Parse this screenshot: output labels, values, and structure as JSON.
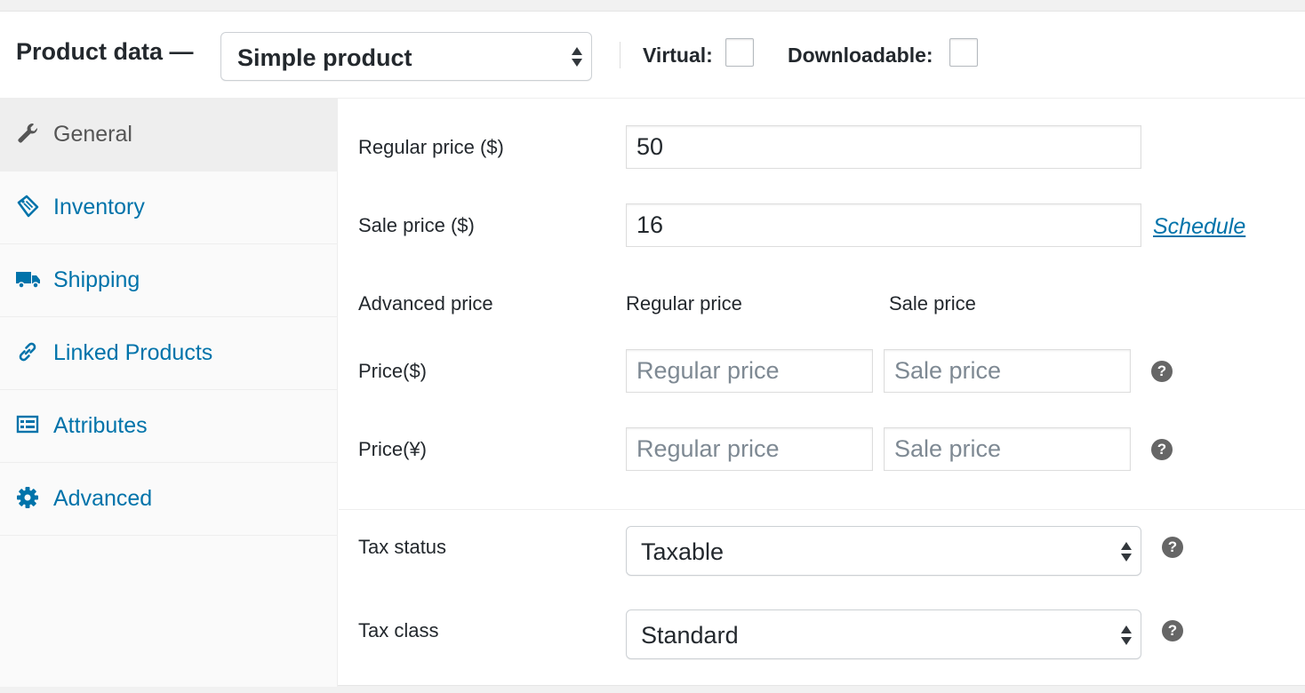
{
  "header": {
    "title": "Product data —",
    "product_type": "Simple product",
    "virtual_label": "Virtual:",
    "virtual_checked": false,
    "downloadable_label": "Downloadable:",
    "downloadable_checked": false
  },
  "sidebar": {
    "items": [
      {
        "label": "General",
        "icon": "wrench-icon",
        "active": true
      },
      {
        "label": "Inventory",
        "icon": "tag-icon",
        "active": false
      },
      {
        "label": "Shipping",
        "icon": "truck-icon",
        "active": false
      },
      {
        "label": "Linked Products",
        "icon": "link-icon",
        "active": false
      },
      {
        "label": "Attributes",
        "icon": "list-icon",
        "active": false
      },
      {
        "label": "Advanced",
        "icon": "gear-icon",
        "active": false
      }
    ]
  },
  "general": {
    "regular_price_label": "Regular price ($)",
    "regular_price_value": "50",
    "sale_price_label": "Sale price ($)",
    "sale_price_value": "16",
    "schedule_link": "Schedule",
    "advanced_price_label": "Advanced price",
    "col_regular": "Regular price",
    "col_sale": "Sale price",
    "rows": [
      {
        "label": "Price($)",
        "regular_placeholder": "Regular price",
        "sale_placeholder": "Sale price"
      },
      {
        "label": "Price(¥)",
        "regular_placeholder": "Regular price",
        "sale_placeholder": "Sale price"
      }
    ],
    "help_glyph": "?",
    "tax_status_label": "Tax status",
    "tax_status_value": "Taxable",
    "tax_class_label": "Tax class",
    "tax_class_value": "Standard"
  },
  "colors": {
    "link": "#0073aa",
    "active_tab_bg": "#eeeeee",
    "sidebar_bg": "#fafafa",
    "help_bg": "#666666"
  }
}
